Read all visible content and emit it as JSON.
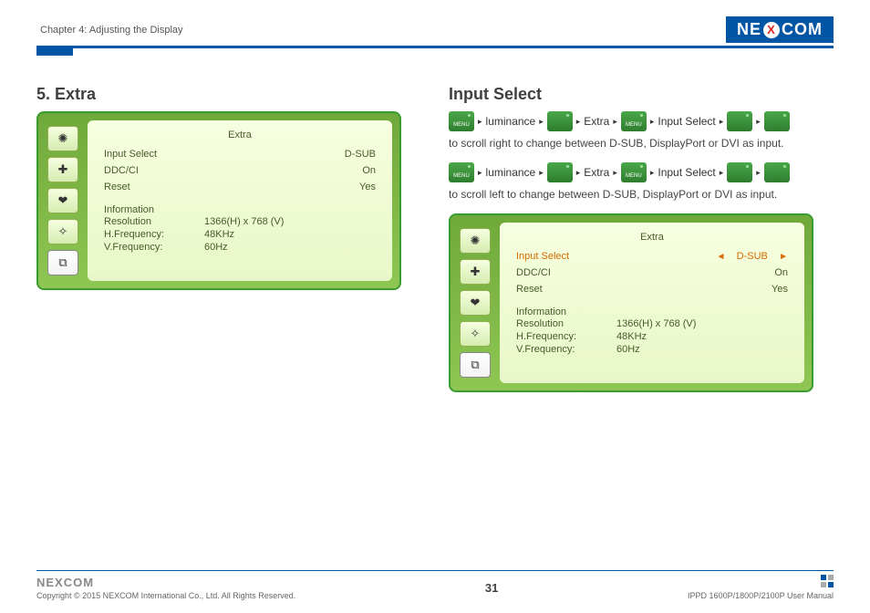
{
  "header": {
    "chapter": "Chapter 4: Adjusting the Display",
    "logo_parts": {
      "a": "NE",
      "x": "X",
      "b": "COM"
    }
  },
  "left": {
    "title": "5. Extra",
    "osd": {
      "title": "Extra",
      "rows": [
        {
          "label": "Input Select",
          "value": "D-SUB"
        },
        {
          "label": "DDC/CI",
          "value": "On"
        },
        {
          "label": "Reset",
          "value": "Yes"
        }
      ],
      "info_label": "Information",
      "info": [
        {
          "k": "Resolution",
          "v": "1366(H)  x  768 (V)"
        },
        {
          "k": "H.Frequency:",
          "v": "48KHz"
        },
        {
          "k": "V.Frequency:",
          "v": "60Hz"
        }
      ]
    }
  },
  "right": {
    "title": "Input Select",
    "crumb_labels": {
      "menu": "MENU",
      "lum": "luminance",
      "extra": "Extra",
      "input": "Input Select"
    },
    "desc1": "to scroll right to change between D-SUB, DisplayPort or DVI as input.",
    "desc2": "to scroll left to change between D-SUB, DisplayPort or DVI as input.",
    "osd": {
      "title": "Extra",
      "active": {
        "label": "Input Select",
        "value": "D-SUB",
        "left_arrow": "◄",
        "right_arrow": "►"
      },
      "rows": [
        {
          "label": "DDC/CI",
          "value": "On"
        },
        {
          "label": "Reset",
          "value": "Yes"
        }
      ],
      "info_label": "Information",
      "info": [
        {
          "k": "Resolution",
          "v": "1366(H)  x  768 (V)"
        },
        {
          "k": "H.Frequency:",
          "v": "48KHz"
        },
        {
          "k": "V.Frequency:",
          "v": "60Hz"
        }
      ]
    }
  },
  "footer": {
    "logo": "NEXCOM",
    "copyright": "Copyright © 2015 NEXCOM International Co., Ltd. All Rights Reserved.",
    "page": "31",
    "manual": "IPPD 1600P/1800P/2100P User Manual"
  },
  "icons": {
    "i1": "✺",
    "i2": "✚",
    "i3": "❤",
    "i4": "✧",
    "i5": "⧉"
  },
  "tri": "▸"
}
